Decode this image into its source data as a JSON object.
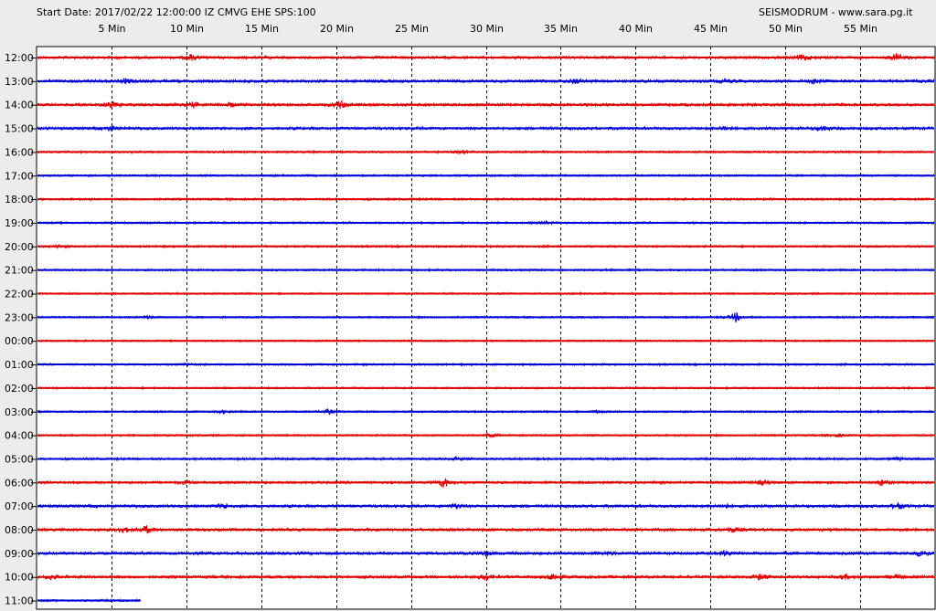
{
  "header": {
    "left": "Start Date: 2017/02/22 12:00:00 IZ CMVG EHE SPS:100",
    "right": "SEISMODRUM - www.sara.pg.it"
  },
  "colors": {
    "red": "#e00000",
    "blue": "#0000d8",
    "grid": "#000000",
    "background": "#ffffff"
  },
  "chart_data": {
    "type": "line",
    "x_unit": "minutes",
    "xlim": [
      0,
      60
    ],
    "minute_ticks": [
      5,
      10,
      15,
      20,
      25,
      30,
      35,
      40,
      45,
      50,
      55
    ],
    "minute_tick_labels": [
      "5 Min",
      "10 Min",
      "15 Min",
      "20 Min",
      "25 Min",
      "30 Min",
      "35 Min",
      "40 Min",
      "45 Min",
      "50 Min",
      "55 Min"
    ],
    "rows": [
      {
        "label": "12:00",
        "color": "red",
        "noise": 0.75,
        "events": [
          [
            10.3,
            3
          ],
          [
            51.2,
            3.5
          ],
          [
            57.5,
            5
          ]
        ]
      },
      {
        "label": "13:00",
        "color": "blue",
        "noise": 0.9,
        "events": [
          [
            6,
            2.5
          ],
          [
            36,
            2.5
          ],
          [
            46,
            2
          ],
          [
            52,
            2.5
          ]
        ]
      },
      {
        "label": "14:00",
        "color": "red",
        "noise": 0.85,
        "events": [
          [
            5,
            3
          ],
          [
            10.5,
            2.5
          ],
          [
            20.3,
            4.5
          ],
          [
            13,
            2
          ]
        ]
      },
      {
        "label": "15:00",
        "color": "blue",
        "noise": 0.85,
        "events": [
          [
            5,
            2.5
          ],
          [
            46,
            2.5
          ],
          [
            52.5,
            3
          ]
        ]
      },
      {
        "label": "16:00",
        "color": "red",
        "noise": 0.45,
        "events": [
          [
            28.5,
            1.5
          ]
        ]
      },
      {
        "label": "17:00",
        "color": "blue",
        "noise": 0.4,
        "events": []
      },
      {
        "label": "18:00",
        "color": "red",
        "noise": 0.5,
        "events": []
      },
      {
        "label": "19:00",
        "color": "blue",
        "noise": 0.45,
        "events": [
          [
            34,
            1.2
          ]
        ]
      },
      {
        "label": "20:00",
        "color": "red",
        "noise": 0.45,
        "events": [
          [
            1.3,
            1.5
          ]
        ]
      },
      {
        "label": "21:00",
        "color": "blue",
        "noise": 0.4,
        "events": []
      },
      {
        "label": "22:00",
        "color": "red",
        "noise": 0.35,
        "events": []
      },
      {
        "label": "23:00",
        "color": "blue",
        "noise": 0.35,
        "events": [
          [
            7.5,
            1.5
          ],
          [
            46.7,
            5
          ]
        ]
      },
      {
        "label": "00:00",
        "color": "red",
        "noise": 0.3,
        "events": []
      },
      {
        "label": "01:00",
        "color": "blue",
        "noise": 0.4,
        "events": [
          [
            10,
            1.2
          ]
        ]
      },
      {
        "label": "02:00",
        "color": "red",
        "noise": 0.35,
        "events": []
      },
      {
        "label": "03:00",
        "color": "blue",
        "noise": 0.35,
        "events": [
          [
            19.5,
            2.5
          ],
          [
            12.5,
            1.5
          ],
          [
            37.5,
            1.5
          ]
        ]
      },
      {
        "label": "04:00",
        "color": "red",
        "noise": 0.4,
        "events": [
          [
            30.3,
            2
          ],
          [
            53.5,
            1.5
          ]
        ]
      },
      {
        "label": "05:00",
        "color": "blue",
        "noise": 0.55,
        "events": [
          [
            28,
            1.5
          ],
          [
            57.5,
            1.5
          ]
        ]
      },
      {
        "label": "06:00",
        "color": "red",
        "noise": 0.7,
        "events": [
          [
            27.2,
            5.5
          ],
          [
            48.5,
            2.5
          ],
          [
            56.5,
            3.5
          ],
          [
            10,
            2
          ]
        ]
      },
      {
        "label": "07:00",
        "color": "blue",
        "noise": 0.85,
        "events": [
          [
            12.5,
            3
          ],
          [
            28,
            2.5
          ],
          [
            46,
            2
          ],
          [
            57.5,
            3.5
          ]
        ]
      },
      {
        "label": "08:00",
        "color": "red",
        "noise": 0.85,
        "events": [
          [
            5.8,
            3
          ],
          [
            7.3,
            4
          ],
          [
            46.5,
            2.5
          ]
        ]
      },
      {
        "label": "09:00",
        "color": "blue",
        "noise": 0.9,
        "events": [
          [
            30,
            2.5
          ],
          [
            38,
            2
          ],
          [
            46,
            2.5
          ],
          [
            59,
            3
          ]
        ]
      },
      {
        "label": "10:00",
        "color": "red",
        "noise": 0.85,
        "events": [
          [
            1,
            2.5
          ],
          [
            30,
            3
          ],
          [
            34.5,
            4
          ],
          [
            48.3,
            3
          ],
          [
            54,
            2.5
          ],
          [
            57.5,
            2
          ]
        ]
      },
      {
        "label": "11:00",
        "color": "blue",
        "noise": 0.5,
        "events": [],
        "end_minute": 7
      }
    ]
  }
}
